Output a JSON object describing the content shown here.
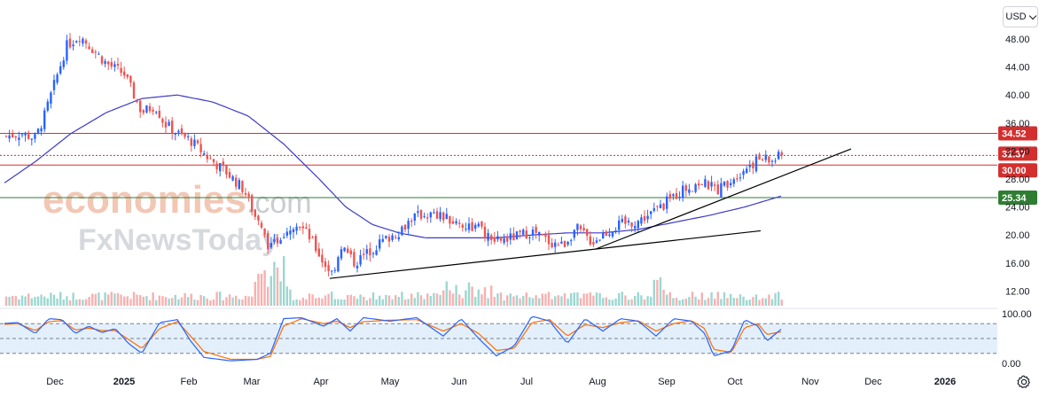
{
  "currency": "USD",
  "watermark": {
    "brand_top": "economies",
    "brand_top_suffix": ".com",
    "brand_bottom": "FxNewsToday"
  },
  "colors": {
    "up": "#2962ff",
    "down": "#ef5350",
    "ma": "#3b3bc8",
    "resistance": "#d32f2f",
    "support": "#2e7d32",
    "trend": "#000000",
    "k_line": "#2962ff",
    "d_line": "#ff6d00",
    "stoch_band": "#e3f0fb"
  },
  "chart_data": {
    "type": "candlestick",
    "price_axis": {
      "ticks": [
        "48.00",
        "44.00",
        "40.00",
        "36.00",
        "32.00",
        "28.00",
        "24.00",
        "20.00",
        "16.00",
        "12.00"
      ],
      "ylim": [
        10.5,
        50.0
      ]
    },
    "stoch_axis": {
      "ticks": [
        "100.00",
        "0.00"
      ],
      "ylim": [
        0,
        100
      ],
      "levels": [
        80,
        50,
        20
      ]
    },
    "x_axis": {
      "ticks": [
        "Dec",
        "2025",
        "Feb",
        "Mar",
        "Apr",
        "May",
        "Jun",
        "Jul",
        "Aug",
        "Sep",
        "Oct",
        "Nov",
        "Dec",
        "2026"
      ],
      "bold": [
        "2025",
        "2026"
      ]
    },
    "price_levels": [
      {
        "value": 34.52,
        "label": "34.52",
        "color": "#d32f2f",
        "style": "solid"
      },
      {
        "value": 31.37,
        "label": "31.37",
        "color": "#d32f2f",
        "style": "dotted"
      },
      {
        "value": 30.0,
        "label": "30.00",
        "color": "#d32f2f",
        "style": "solid"
      },
      {
        "value": 25.34,
        "label": "25.34",
        "color": "#2e7d32",
        "style": "solid"
      }
    ],
    "trendlines": [
      {
        "name": "lower-trendline",
        "points": [
          [
            "Apr-1",
            13.8
          ],
          [
            "Aug-20",
            20.6
          ]
        ]
      },
      {
        "name": "upper-trendline",
        "points": [
          [
            "Jul-28",
            18.0
          ],
          [
            "Nov-08",
            32.3
          ]
        ]
      }
    ],
    "price_path": [
      [
        0,
        34.0
      ],
      [
        25,
        34.5
      ],
      [
        40,
        33.8
      ],
      [
        50,
        37.0
      ],
      [
        60,
        41.0
      ],
      [
        75,
        47.0
      ],
      [
        90,
        48.5
      ],
      [
        105,
        46.5
      ],
      [
        120,
        44.5
      ],
      [
        140,
        43.0
      ],
      [
        160,
        37.5
      ],
      [
        175,
        38.5
      ],
      [
        185,
        36.0
      ],
      [
        200,
        34.5
      ],
      [
        215,
        33.5
      ],
      [
        235,
        31.0
      ],
      [
        255,
        29.0
      ],
      [
        275,
        26.5
      ],
      [
        290,
        22.0
      ],
      [
        305,
        18.0
      ],
      [
        320,
        20.5
      ],
      [
        335,
        22.0
      ],
      [
        350,
        19.5
      ],
      [
        365,
        16.0
      ],
      [
        375,
        14.5
      ],
      [
        385,
        18.5
      ],
      [
        400,
        16.0
      ],
      [
        415,
        17.5
      ],
      [
        430,
        19.0
      ],
      [
        450,
        20.5
      ],
      [
        465,
        22.5
      ],
      [
        480,
        23.0
      ],
      [
        500,
        22.5
      ],
      [
        520,
        21.5
      ],
      [
        540,
        21.0
      ],
      [
        555,
        19.0
      ],
      [
        575,
        19.5
      ],
      [
        600,
        20.5
      ],
      [
        620,
        19.0
      ],
      [
        635,
        18.5
      ],
      [
        650,
        21.0
      ],
      [
        668,
        19.0
      ],
      [
        685,
        20.5
      ],
      [
        700,
        21.5
      ],
      [
        720,
        22.0
      ],
      [
        740,
        23.5
      ],
      [
        755,
        25.0
      ],
      [
        770,
        26.5
      ],
      [
        790,
        27.5
      ],
      [
        810,
        26.5
      ],
      [
        830,
        28.5
      ],
      [
        845,
        30.0
      ],
      [
        860,
        31.0
      ],
      [
        870,
        30.5
      ],
      [
        882,
        31.4
      ]
    ],
    "moving_average": [
      [
        0,
        27.0
      ],
      [
        40,
        30.5
      ],
      [
        80,
        34.5
      ],
      [
        120,
        37.5
      ],
      [
        160,
        39.5
      ],
      [
        200,
        40.0
      ],
      [
        240,
        39.0
      ],
      [
        280,
        37.0
      ],
      [
        320,
        33.0
      ],
      [
        360,
        28.0
      ],
      [
        390,
        24.0
      ],
      [
        420,
        21.5
      ],
      [
        450,
        20.3
      ],
      [
        480,
        19.6
      ],
      [
        520,
        19.6
      ],
      [
        560,
        19.6
      ],
      [
        600,
        20.0
      ],
      [
        640,
        20.3
      ],
      [
        680,
        20.3
      ],
      [
        720,
        20.8
      ],
      [
        760,
        21.8
      ],
      [
        800,
        22.8
      ],
      [
        840,
        24.0
      ],
      [
        882,
        25.6
      ]
    ],
    "stochastic_k": [
      [
        0,
        80
      ],
      [
        20,
        82
      ],
      [
        40,
        60
      ],
      [
        55,
        90
      ],
      [
        70,
        88
      ],
      [
        85,
        60
      ],
      [
        100,
        75
      ],
      [
        115,
        62
      ],
      [
        130,
        70
      ],
      [
        145,
        40
      ],
      [
        160,
        20
      ],
      [
        180,
        82
      ],
      [
        200,
        88
      ],
      [
        215,
        45
      ],
      [
        230,
        12
      ],
      [
        260,
        5
      ],
      [
        290,
        8
      ],
      [
        305,
        20
      ],
      [
        320,
        90
      ],
      [
        340,
        92
      ],
      [
        365,
        75
      ],
      [
        380,
        90
      ],
      [
        395,
        65
      ],
      [
        410,
        92
      ],
      [
        440,
        85
      ],
      [
        470,
        92
      ],
      [
        500,
        55
      ],
      [
        520,
        90
      ],
      [
        540,
        50
      ],
      [
        560,
        15
      ],
      [
        580,
        35
      ],
      [
        600,
        95
      ],
      [
        620,
        85
      ],
      [
        640,
        40
      ],
      [
        660,
        90
      ],
      [
        680,
        65
      ],
      [
        700,
        90
      ],
      [
        720,
        85
      ],
      [
        740,
        55
      ],
      [
        760,
        90
      ],
      [
        780,
        85
      ],
      [
        795,
        60
      ],
      [
        805,
        15
      ],
      [
        825,
        25
      ],
      [
        840,
        88
      ],
      [
        855,
        75
      ],
      [
        865,
        45
      ],
      [
        882,
        70
      ]
    ],
    "stochastic_d": [
      [
        0,
        78
      ],
      [
        20,
        80
      ],
      [
        40,
        66
      ],
      [
        55,
        84
      ],
      [
        70,
        86
      ],
      [
        85,
        67
      ],
      [
        100,
        71
      ],
      [
        115,
        66
      ],
      [
        130,
        66
      ],
      [
        145,
        48
      ],
      [
        160,
        30
      ],
      [
        180,
        70
      ],
      [
        200,
        84
      ],
      [
        215,
        55
      ],
      [
        230,
        24
      ],
      [
        260,
        8
      ],
      [
        290,
        8
      ],
      [
        305,
        14
      ],
      [
        320,
        75
      ],
      [
        340,
        90
      ],
      [
        365,
        80
      ],
      [
        380,
        85
      ],
      [
        395,
        72
      ],
      [
        410,
        84
      ],
      [
        440,
        87
      ],
      [
        470,
        88
      ],
      [
        500,
        65
      ],
      [
        520,
        80
      ],
      [
        540,
        60
      ],
      [
        560,
        26
      ],
      [
        580,
        30
      ],
      [
        600,
        82
      ],
      [
        620,
        88
      ],
      [
        640,
        55
      ],
      [
        660,
        78
      ],
      [
        680,
        72
      ],
      [
        700,
        82
      ],
      [
        720,
        86
      ],
      [
        740,
        65
      ],
      [
        760,
        80
      ],
      [
        780,
        86
      ],
      [
        795,
        70
      ],
      [
        805,
        28
      ],
      [
        825,
        22
      ],
      [
        840,
        72
      ],
      [
        855,
        80
      ],
      [
        865,
        58
      ],
      [
        882,
        64
      ]
    ]
  }
}
